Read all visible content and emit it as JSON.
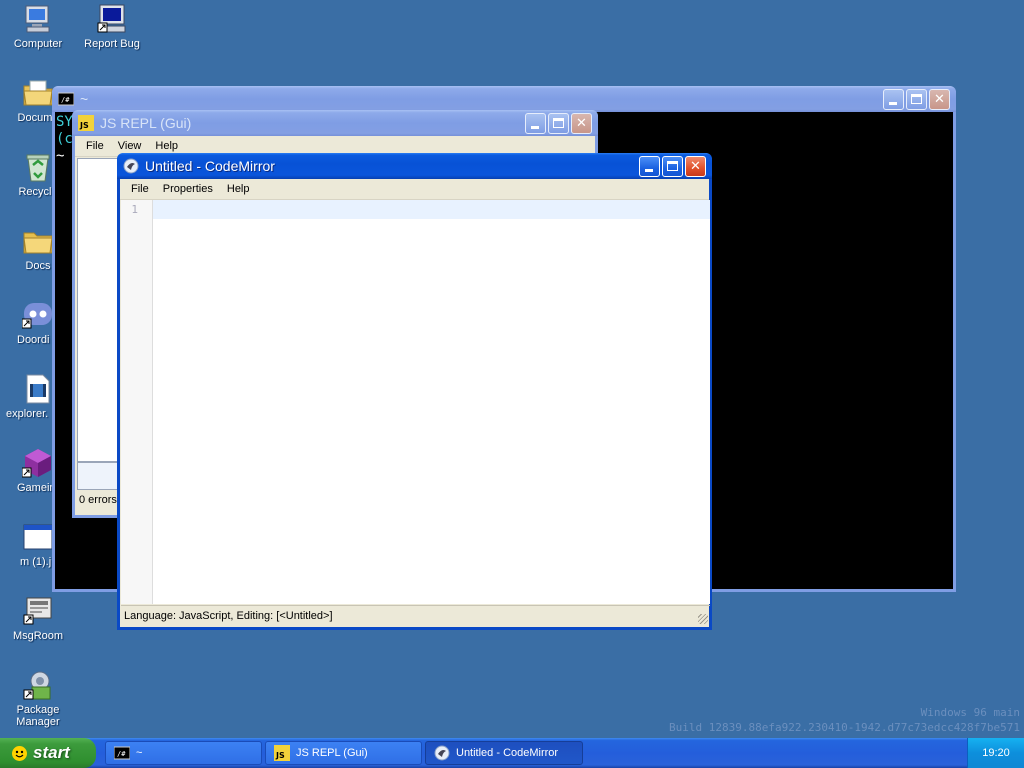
{
  "desktop": {
    "icons": [
      {
        "label": "Computer"
      },
      {
        "label": "Report Bug"
      },
      {
        "label": "Docume"
      },
      {
        "label": "Recycle"
      },
      {
        "label": "Docs"
      },
      {
        "label": "Doordi"
      },
      {
        "label": "explorer."
      },
      {
        "label": "Gamein"
      },
      {
        "label": "m (1).j"
      },
      {
        "label": "MsgRoom"
      },
      {
        "label": "Package Manager"
      }
    ],
    "watermark_line1": "Windows 96 main",
    "watermark_line2": "Build 12839.88efa922.230410-1942.d77c73edcc428f7be571"
  },
  "terminal": {
    "title": "~",
    "lines": [
      "SYS",
      "(c",
      "~ $"
    ]
  },
  "repl": {
    "title": "JS REPL (Gui)",
    "menu": [
      "File",
      "View",
      "Help"
    ],
    "status": "0 errors"
  },
  "editor": {
    "title": "Untitled - CodeMirror",
    "menu": [
      "File",
      "Properties",
      "Help"
    ],
    "line_numbers": [
      "1"
    ],
    "status": "Language: JavaScript, Editing: [<Untitled>]"
  },
  "taskbar": {
    "start_label": "start",
    "tasks": [
      {
        "label": "~"
      },
      {
        "label": "JS REPL (Gui)"
      },
      {
        "label": "Untitled - CodeMirror"
      }
    ],
    "clock": "19:20"
  },
  "colors": {
    "desktop": "#3a6ea5",
    "active_title": "#0852d6",
    "inactive_title": "#7f9de4"
  }
}
